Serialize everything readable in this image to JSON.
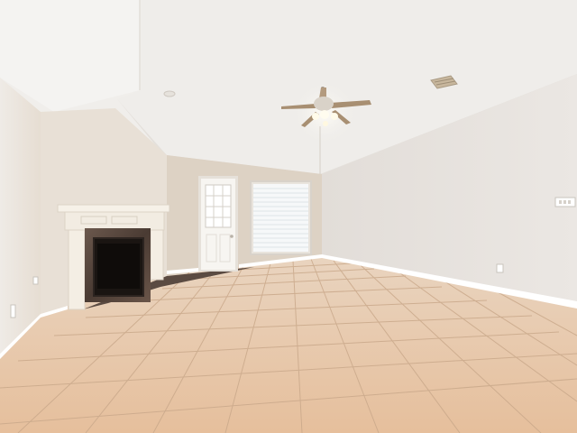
{
  "photo": {
    "scene": "empty-living-room",
    "palette": {
      "ceiling": "#f1efec",
      "ceiling_slope": "#e7e4e0",
      "wall_left": "#ece7e1",
      "wall_back": "#ddd3c6",
      "wall_right": "#e6e2de",
      "floor_tile": "#e7c7a8",
      "grout": "#c9a98a",
      "baseboard": "#ffffff",
      "mantel": "#f4efe6",
      "granite": "#5a4a42",
      "firebox": "#151210",
      "door": "#f7f5f1",
      "blinds": "#f4f6f8"
    }
  }
}
